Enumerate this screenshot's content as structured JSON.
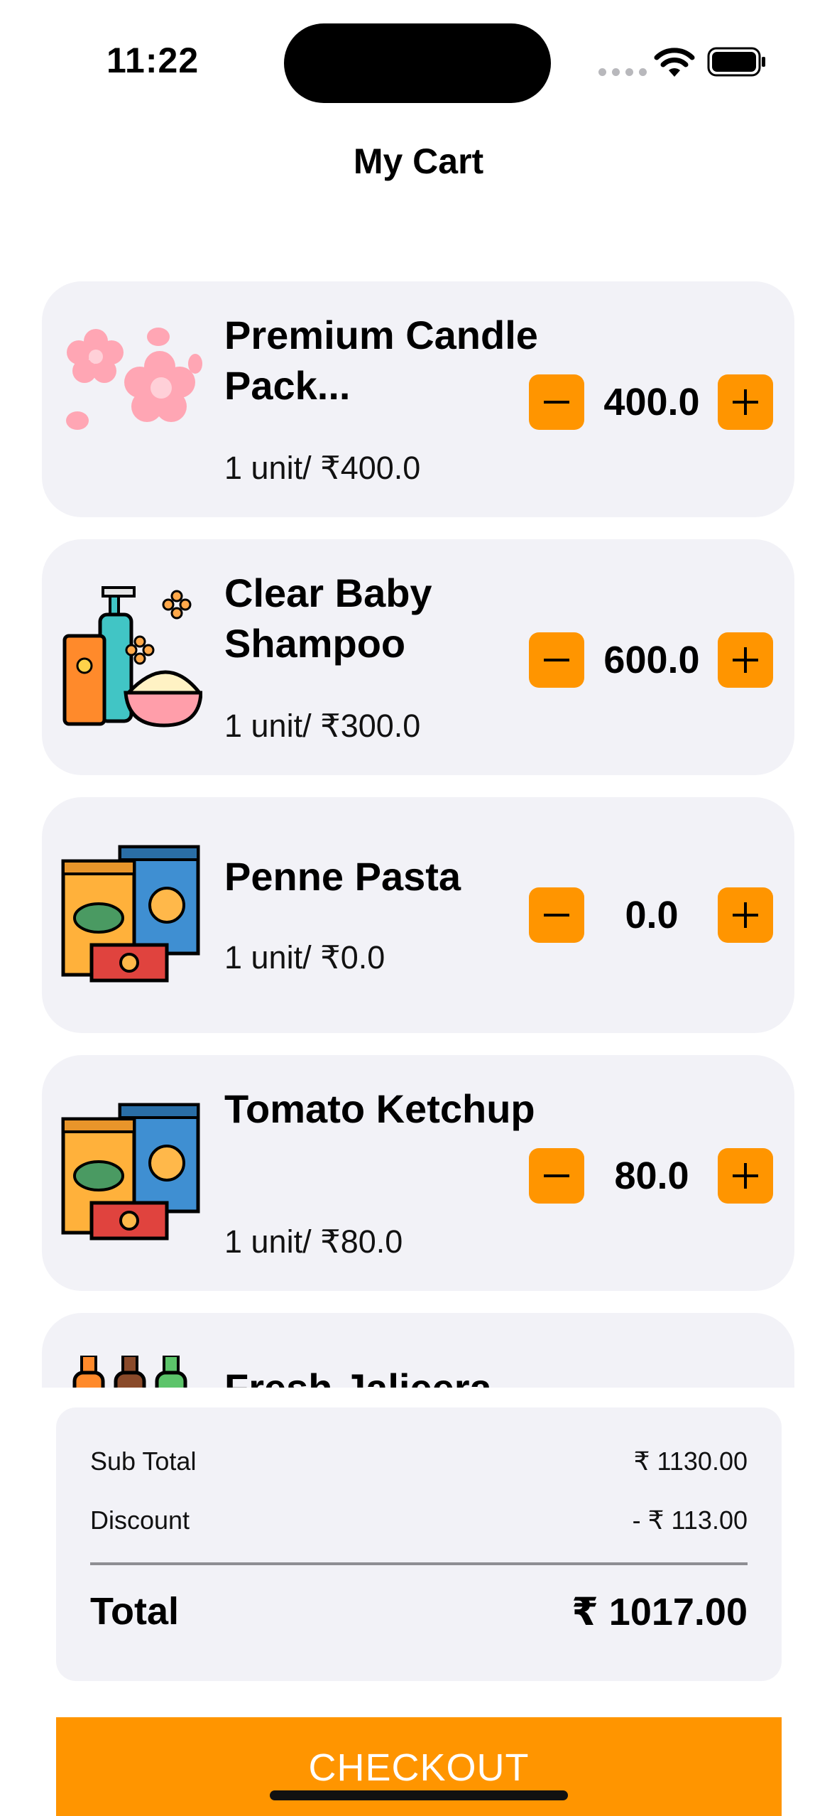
{
  "status_bar": {
    "time": "11:22",
    "icons": [
      "cellular-signal-icon",
      "wifi-icon",
      "battery-icon"
    ]
  },
  "header": {
    "title": "My Cart"
  },
  "cart": {
    "items": [
      {
        "name": "Premium Candle Pack...",
        "unit_price": "1 unit/ ₹400.0",
        "quantity_value": "400.0",
        "image": "cherry-blossom-image"
      },
      {
        "name": "Clear Baby Shampoo",
        "unit_price": "1 unit/ ₹300.0",
        "quantity_value": "600.0",
        "image": "baby-care-products-image"
      },
      {
        "name": "Penne Pasta",
        "unit_price": "1 unit/ ₹0.0",
        "quantity_value": "0.0",
        "image": "snack-packets-image"
      },
      {
        "name": "Tomato Ketchup",
        "unit_price": "1 unit/ ₹80.0",
        "quantity_value": "80.0",
        "image": "snack-packets-image"
      },
      {
        "name": "Fresh Jaljeera",
        "image": "bottles-image"
      }
    ]
  },
  "summary": {
    "subtotal_label": "Sub Total",
    "subtotal_value": "₹ 1130.00",
    "discount_label": "Discount",
    "discount_value": "- ₹ 113.00",
    "total_label": "Total",
    "total_value": "₹ 1017.00"
  },
  "checkout": {
    "label": "CHECKOUT"
  },
  "colors": {
    "accent": "#ff9500",
    "card_bg": "#f2f2f7",
    "divider": "#8e8e93"
  }
}
